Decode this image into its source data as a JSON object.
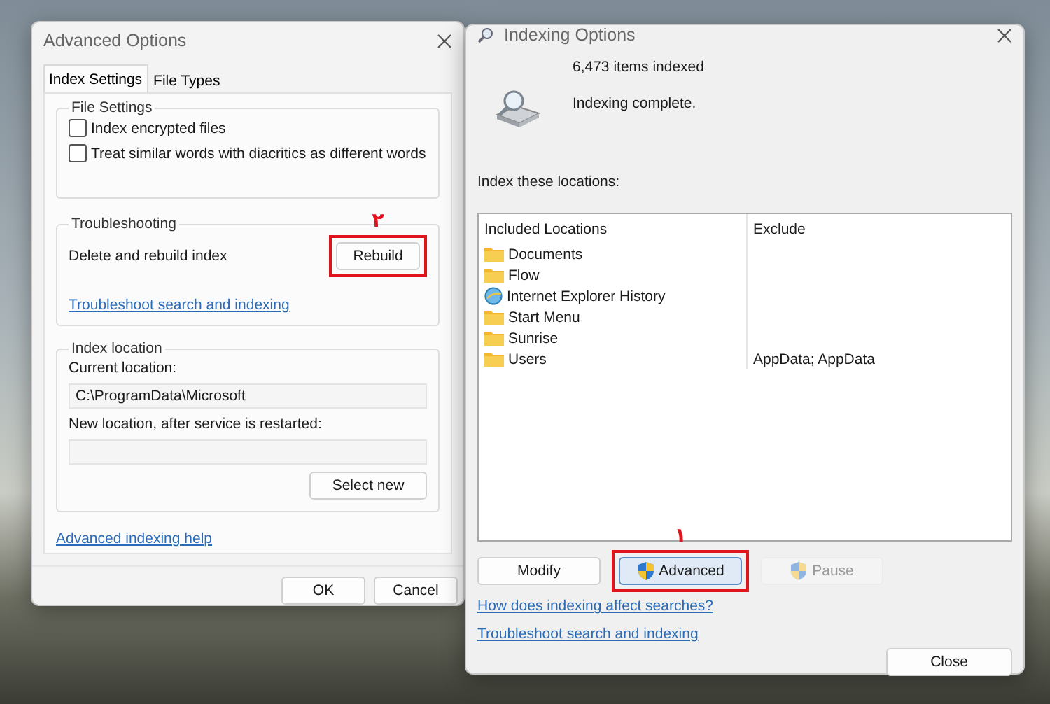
{
  "advanced_window": {
    "title": "Advanced Options",
    "tabs": [
      {
        "label": "Index Settings",
        "selected": true
      },
      {
        "label": "File Types",
        "selected": false
      }
    ],
    "file_settings": {
      "legend": "File Settings",
      "options": [
        {
          "label": "Index encrypted files",
          "checked": false
        },
        {
          "label": "Treat similar words with diacritics as different words",
          "checked": false
        }
      ]
    },
    "troubleshooting": {
      "legend": "Troubleshooting",
      "description": "Delete and rebuild index",
      "button": {
        "label": "Rebuild",
        "highlighted": true,
        "annotation": "۲"
      },
      "link": "Troubleshoot search and indexing"
    },
    "index_location": {
      "legend": "Index location",
      "current_label": "Current location:",
      "current_value": "C:\\ProgramData\\Microsoft",
      "new_label": "New location, after service is restarted:",
      "button": "Select new"
    },
    "help_link": "Advanced indexing help",
    "buttons": [
      "OK",
      "Cancel"
    ]
  },
  "indexing_window": {
    "title": "Indexing Options",
    "items_indexed": "6,473 items indexed",
    "status": "Indexing complete.",
    "locations_label": "Index these locations:",
    "table": {
      "columns": [
        "Included Locations",
        "Exclude"
      ],
      "rows": [
        {
          "name": "Documents",
          "kind": "folder"
        },
        {
          "name": "Flow",
          "kind": "folder"
        },
        {
          "name": "Internet Explorer History",
          "kind": "history"
        },
        {
          "name": "Start Menu",
          "kind": "folder"
        },
        {
          "name": "Sunrise",
          "kind": "folder"
        },
        {
          "name": "Users",
          "kind": "folder",
          "exclude": "AppData; AppData"
        }
      ]
    },
    "buttons": [
      {
        "label": "Modify",
        "kind": "plain",
        "focused": false,
        "disabled": false,
        "highlighted": false
      },
      {
        "label": "Advanced",
        "kind": "shield",
        "focused": true,
        "disabled": false,
        "highlighted": true,
        "annotation": "۱"
      },
      {
        "label": "Pause",
        "kind": "shield",
        "focused": false,
        "disabled": true,
        "highlighted": false
      }
    ],
    "links": [
      "How does indexing affect searches?",
      "Troubleshoot search and indexing"
    ],
    "close_button": "Close"
  }
}
